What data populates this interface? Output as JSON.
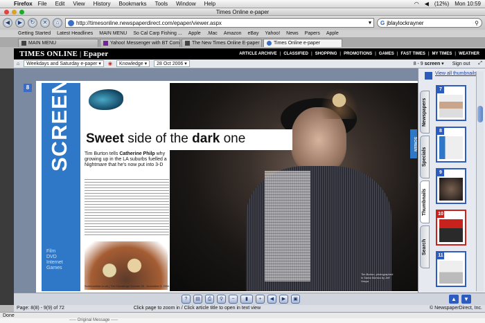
{
  "menubar": {
    "app": "Firefox",
    "items": [
      "File",
      "Edit",
      "View",
      "History",
      "Bookmarks",
      "Tools",
      "Window",
      "Help"
    ],
    "battery": "(12%)",
    "clock": "Mon 10:59"
  },
  "window": {
    "title": "Times Online e-paper"
  },
  "nav": {
    "url": "http://timesonline.newspaperdirect.com/epaper/viewer.aspx",
    "search_value": "jblaylockrayner",
    "search_engine": "G"
  },
  "bookmarks": [
    "Getting Started",
    "Latest Headlines",
    "MAIN MENU",
    "So Cal Carp Fishing ...",
    "Apple",
    ".Mac",
    "Amazon",
    "eBay",
    "Yahoo!",
    "News",
    "Papers",
    "Apple"
  ],
  "tabs": [
    {
      "label": "MAIN MENU"
    },
    {
      "label": "Yahoo! Messenger with BT Com..."
    },
    {
      "label": "The New Times Online E-paper"
    },
    {
      "label": "Times Online e-paper"
    }
  ],
  "times_header": {
    "brand": "TIMES ONLINE",
    "sep": "|",
    "product": "Epaper",
    "links": [
      "ARTICLE ARCHIVE",
      "CLASSIFIED",
      "SHOPPING",
      "PROMOTIONS",
      "GAMES",
      "FAST TIMES",
      "MY TIMES",
      "WEATHER"
    ]
  },
  "epaper_toolbar": {
    "edition": "Weekdays and Saturday e-paper",
    "section": "Knowledge",
    "date": "28 Oct 2006",
    "pages": "8 - 9",
    "view": "screen",
    "signout": "Sign out"
  },
  "page_numbers": {
    "left": "8",
    "right": "9"
  },
  "article": {
    "band_word": "SCREEN",
    "band_menu": [
      "Film",
      "DVD",
      "Internet",
      "Games"
    ],
    "headline_strong_1": "Sweet",
    "headline_mid": "side of the",
    "headline_strong_2": "dark",
    "headline_end": "one",
    "standfirst_pre": "Tim Burton tells",
    "standfirst_name": "Catherine Philp",
    "standfirst_post": "why growing up in the LA suburbs fuelled a Nightmare that he's now put into 3-D",
    "side_tab": "SCREEN",
    "photo_caption": "Tim Burton, photographed in Santa Monica by Jeff Vespa",
    "footer": "Screenonline.co.uk | The Knowledge October 28 - November 3, 2006"
  },
  "right_panel": {
    "view_all": "View all thumbnails",
    "tabs": [
      "Newspapers",
      "Specials",
      "Thumbnails",
      "Search"
    ],
    "thumbs": [
      {
        "n": "7",
        "red": false
      },
      {
        "n": "8",
        "red": false
      },
      {
        "n": "9",
        "red": false
      },
      {
        "n": "10",
        "red": true
      },
      {
        "n": "11",
        "red": false
      }
    ]
  },
  "bottom_toolbar": {
    "tools": [
      "?",
      "page",
      "print",
      "zoom",
      "minus",
      "plus",
      "prev",
      "next",
      "save"
    ]
  },
  "status": {
    "page_info": "Page: 8(8) - 9(9) of 72",
    "hint": "Click page to zoom in / Click article title to open in text view",
    "copyright": "© NewspaperDirect, Inc."
  },
  "browser_status": "Done",
  "mail_strip": "----- Original Message -----",
  "colors": {
    "blue": "#2f78c8",
    "times_black": "#000000",
    "thumb_red": "#c8221c"
  }
}
